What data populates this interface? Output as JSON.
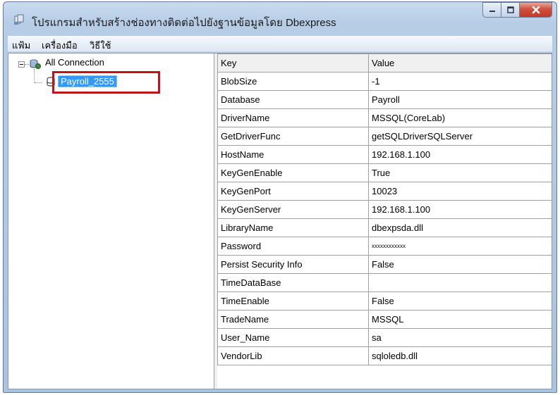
{
  "window": {
    "title": "โปรแกรมสำหรับสร้างช่องทางติดต่อไปยังฐานข้อมูลโดย Dbexpress",
    "controls": [
      "minimize-icon",
      "maximize-icon",
      "close-icon"
    ]
  },
  "menu": {
    "file": "แฟ้ม",
    "tools": "เครื่องมือ",
    "help": "วิธีใช้"
  },
  "tree": {
    "root_label": "All Connection",
    "child_label": "Payroll_2555"
  },
  "grid": {
    "columns": [
      "Key",
      "Value"
    ],
    "rows": [
      {
        "key": "BlobSize",
        "value": "-1"
      },
      {
        "key": "Database",
        "value": "Payroll"
      },
      {
        "key": "DriverName",
        "value": "MSSQL(CoreLab)"
      },
      {
        "key": "GetDriverFunc",
        "value": "getSQLDriverSQLServer"
      },
      {
        "key": "HostName",
        "value": "192.168.1.100"
      },
      {
        "key": "KeyGenEnable",
        "value": "True"
      },
      {
        "key": "KeyGenPort",
        "value": "10023"
      },
      {
        "key": "KeyGenServer",
        "value": "192.168.1.100"
      },
      {
        "key": "LibraryName",
        "value": "dbexpsda.dll"
      },
      {
        "key": "Password",
        "value": "xxxxxxxxxxxx"
      },
      {
        "key": "Persist Security Info",
        "value": "False"
      },
      {
        "key": "TimeDataBase",
        "value": ""
      },
      {
        "key": "TimeEnable",
        "value": "False"
      },
      {
        "key": "TradeName",
        "value": "MSSQL"
      },
      {
        "key": "User_Name",
        "value": "sa"
      },
      {
        "key": "VendorLib",
        "value": "sqloledb.dll"
      }
    ]
  },
  "colors": {
    "selection": "#3399ff",
    "highlight_border": "#c0141c",
    "close_button": "#c23a27"
  }
}
